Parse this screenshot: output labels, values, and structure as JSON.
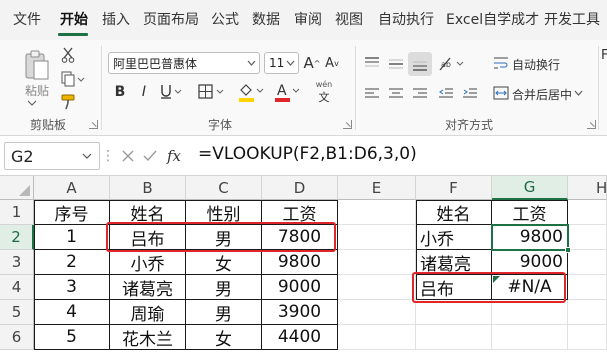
{
  "menu": {
    "tabs": [
      "文件",
      "开始",
      "插入",
      "页面布局",
      "公式",
      "数据",
      "审阅",
      "视图",
      "自动执行",
      "Excel自学成才",
      "开发工具"
    ],
    "active": "开始",
    "accent": "#1e7145"
  },
  "ribbon": {
    "clipboard": {
      "paste_label": "粘贴",
      "group_label": "剪贴板"
    },
    "font": {
      "font_name": "阿里巴巴普惠体",
      "font_size": "11",
      "phonetic_label": "wén",
      "group_label": "字体",
      "fill_color": "#ffd400",
      "font_color": "#e0262b"
    },
    "alignment": {
      "wrap_label": "自动换行",
      "merge_label": "合并后居中",
      "group_label": "对齐方式"
    },
    "cut_partial": "F"
  },
  "formula_bar": {
    "name_box": "G2",
    "fx_label": "fx",
    "formula": "=VLOOKUP(F2,B1:D6,3,0)"
  },
  "grid": {
    "columns": [
      "A",
      "B",
      "C",
      "D",
      "E",
      "F",
      "G"
    ],
    "partial_column": "H",
    "rows": [
      "1",
      "2",
      "3",
      "4",
      "5",
      "6"
    ],
    "selected_cell": "G2",
    "table": {
      "headers": [
        "序号",
        "姓名",
        "性别",
        "工资"
      ],
      "rows": [
        [
          "1",
          "吕布",
          "男",
          "7800"
        ],
        [
          "2",
          "小乔",
          "女",
          "9800"
        ],
        [
          "3",
          "诸葛亮",
          "男",
          "9000"
        ],
        [
          "4",
          "周瑜",
          "男",
          "3900"
        ],
        [
          "5",
          "花木兰",
          "女",
          "4400"
        ]
      ]
    },
    "lookup": {
      "headers": [
        "姓名",
        "工资"
      ],
      "rows": [
        [
          "小乔",
          "9800"
        ],
        [
          "诸葛亮",
          "9000"
        ],
        [
          "吕布",
          "#N/A"
        ]
      ]
    },
    "highlight_color": "#e0262b"
  }
}
